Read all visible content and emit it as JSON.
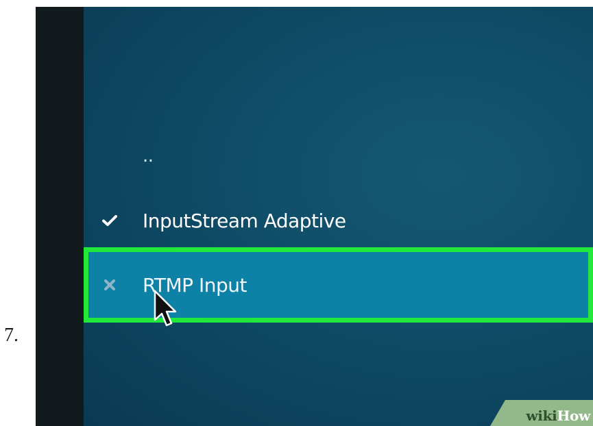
{
  "step": {
    "number": "7."
  },
  "menu": {
    "items": [
      {
        "label": "..",
        "icon": "none",
        "state": "parent-directory"
      },
      {
        "label": "InputStream Adaptive",
        "icon": "checkmark-icon",
        "state": "enabled"
      },
      {
        "label": "RTMP Input",
        "icon": "x-icon",
        "state": "disabled",
        "highlighted": true
      }
    ]
  },
  "watermark": {
    "wiki": "wiki",
    "how": "How"
  },
  "colors": {
    "panel_background": "#0f4b66",
    "left_strip": "#121a1d",
    "selected_row": "#0d82a6",
    "highlight_border": "#22e83c",
    "text": "#ffffff",
    "x_icon": "#8fb6c6"
  }
}
